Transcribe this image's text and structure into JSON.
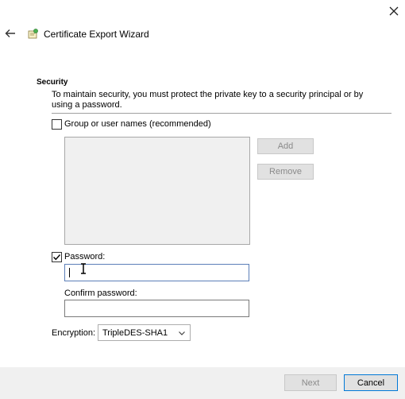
{
  "window": {
    "title": "Certificate Export Wizard",
    "close_icon": "close-icon",
    "back_icon": "back-arrow-icon",
    "wizard_icon": "certificate-icon"
  },
  "security": {
    "heading": "Security",
    "description": "To maintain security, you must protect the private key to a security principal or by using a password.",
    "group_checkbox": {
      "label": "Group or user names (recommended)",
      "checked": false
    },
    "add_button": "Add",
    "remove_button": "Remove",
    "password_checkbox": {
      "label": "Password:",
      "checked": true
    },
    "password_value": "",
    "confirm_label": "Confirm password:",
    "confirm_value": "",
    "encryption_label": "Encryption:",
    "encryption_selected": "TripleDES-SHA1"
  },
  "footer": {
    "next_button": "Next",
    "cancel_button": "Cancel"
  },
  "colors": {
    "accent": "#0078d7",
    "footer_bg": "#f0f0f0",
    "disabled_text": "#8a8a8a"
  }
}
